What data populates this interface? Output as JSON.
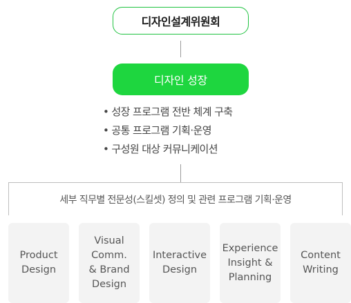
{
  "committee": {
    "label": "디자인설계위원회"
  },
  "growth": {
    "label": "디자인 성장",
    "items": [
      "성장 프로그램 전반 체계 구축",
      "공통 프로그램 기획·운영",
      "구성원 대상 커뮤니케이션"
    ]
  },
  "skillset": {
    "label": "세부 직무별 전문성(스킬셋) 정의 및 관련 프로그램 기획·운영"
  },
  "jobs": [
    {
      "label": "Product\nDesign"
    },
    {
      "label": "Visual\nComm.\n& Brand\nDesign"
    },
    {
      "label": "Interactive\nDesign"
    },
    {
      "label": "Experience\nInsight &\nPlanning"
    },
    {
      "label": "Content\nWriting"
    }
  ],
  "colors": {
    "accent": "#1ed63f",
    "accent_border": "#1ec23f",
    "line": "#9a9a9a",
    "card": "#f3f3f3"
  }
}
